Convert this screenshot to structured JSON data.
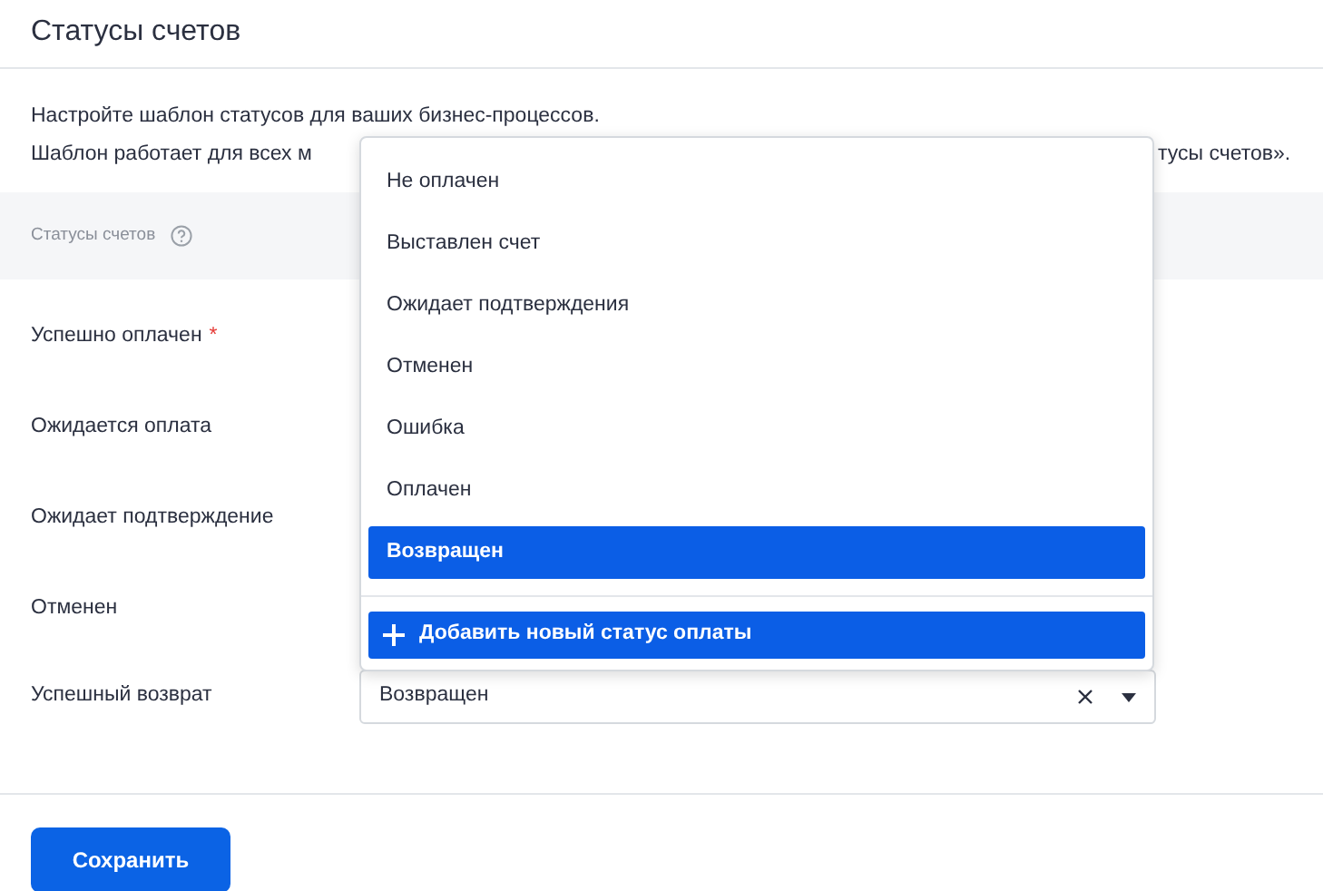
{
  "title": "Статусы счетов",
  "description": {
    "line_1": "Настройте шаблон статусов для ваших бизнес-процессов.",
    "line_2_start": "Шаблон работает для всех м",
    "line_2_end": "тусы счетов»."
  },
  "section": {
    "label": "Статусы счетов"
  },
  "required_marker": "*",
  "fields": [
    {
      "label": "Успешно оплачен",
      "required": true
    },
    {
      "label": "Ожидается оплата"
    },
    {
      "label": "Ожидает подтверждение"
    },
    {
      "label": "Отменен"
    },
    {
      "label": "Успешный возврат",
      "value": "Возвращен"
    }
  ],
  "dropdown": {
    "options": [
      {
        "label": "Не оплачен",
        "selected": false
      },
      {
        "label": "Выставлен счет",
        "selected": false
      },
      {
        "label": "Ожидает подтверждения",
        "selected": false
      },
      {
        "label": "Отменен",
        "selected": false
      },
      {
        "label": "Ошибка",
        "selected": false
      },
      {
        "label": "Оплачен",
        "selected": false
      },
      {
        "label": "Возвращен",
        "selected": true
      }
    ],
    "add_button": "Добавить новый статус оплаты"
  },
  "save_button": "Сохранить"
}
